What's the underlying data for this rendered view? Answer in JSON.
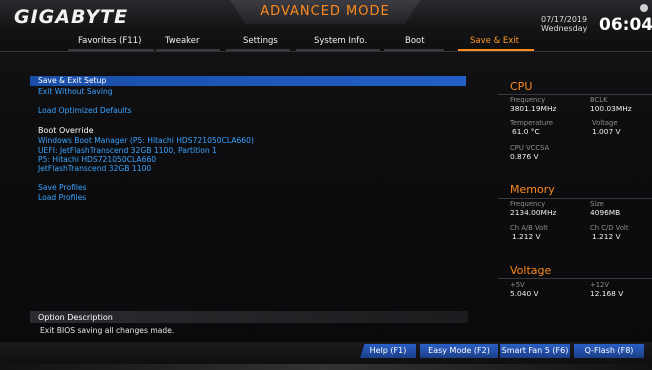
{
  "header": {
    "brand": "GIGABYTE",
    "mode": "ADVANCED MODE",
    "date": "07/17/2019",
    "weekday": "Wednesday",
    "time": "06:04"
  },
  "menu": {
    "items": [
      {
        "label": "Favorites (F11)"
      },
      {
        "label": "Tweaker"
      },
      {
        "label": "Settings"
      },
      {
        "label": "System Info."
      },
      {
        "label": "Boot"
      },
      {
        "label": "Save & Exit"
      }
    ],
    "active": "Save & Exit"
  },
  "main": {
    "save_exit_setup": "Save & Exit Setup",
    "exit_without_saving": "Exit Without Saving",
    "load_optimized_defaults": "Load Optimized Defaults",
    "boot_override_heading": "Boot Override",
    "boot_items": [
      "Windows Boot Manager (P5: Hitachi HDS721050CLA660)",
      "UEFI: JetFlashTranscend 32GB 1100, Partition 1",
      "P5: Hitachi HDS721050CLA660",
      "JetFlashTranscend 32GB 1100"
    ],
    "save_profiles": "Save Profiles",
    "load_profiles": "Load Profiles"
  },
  "panel": {
    "cpu": {
      "title": "CPU",
      "frequency_label": "Frequency",
      "frequency_value": "3801.19MHz",
      "bclk_label": "BCLK",
      "bclk_value": "100.03MHz",
      "temperature_label": "Temperature",
      "temperature_value": "61.0 °C",
      "voltage_label": "Voltage",
      "voltage_value": "1.007 V",
      "vccsa_label": "CPU VCCSA",
      "vccsa_value": "0.876 V"
    },
    "memory": {
      "title": "Memory",
      "frequency_label": "Frequency",
      "frequency_value": "2134.00MHz",
      "size_label": "Size",
      "size_value": "4096MB",
      "chab_label": "Ch A/B Volt",
      "chab_value": "1.212 V",
      "chcd_label": "Ch C/D Volt",
      "chcd_value": "1.212 V"
    },
    "voltage": {
      "title": "Voltage",
      "v5_label": "+5V",
      "v5_value": "5.040 V",
      "v12_label": "+12V",
      "v12_value": "12.168 V"
    }
  },
  "description": {
    "title": "Option Description",
    "text": "Exit BIOS saving all changes made."
  },
  "footer": {
    "help": "Help (F1)",
    "easy_mode": "Easy Mode (F2)",
    "smart_fan": "Smart Fan 5 (F6)",
    "qflash": "Q-Flash (F8)"
  },
  "colors": {
    "accent": "#ff8a1c",
    "link_blue": "#3aa3ff",
    "selection_blue": "#225fc6"
  }
}
